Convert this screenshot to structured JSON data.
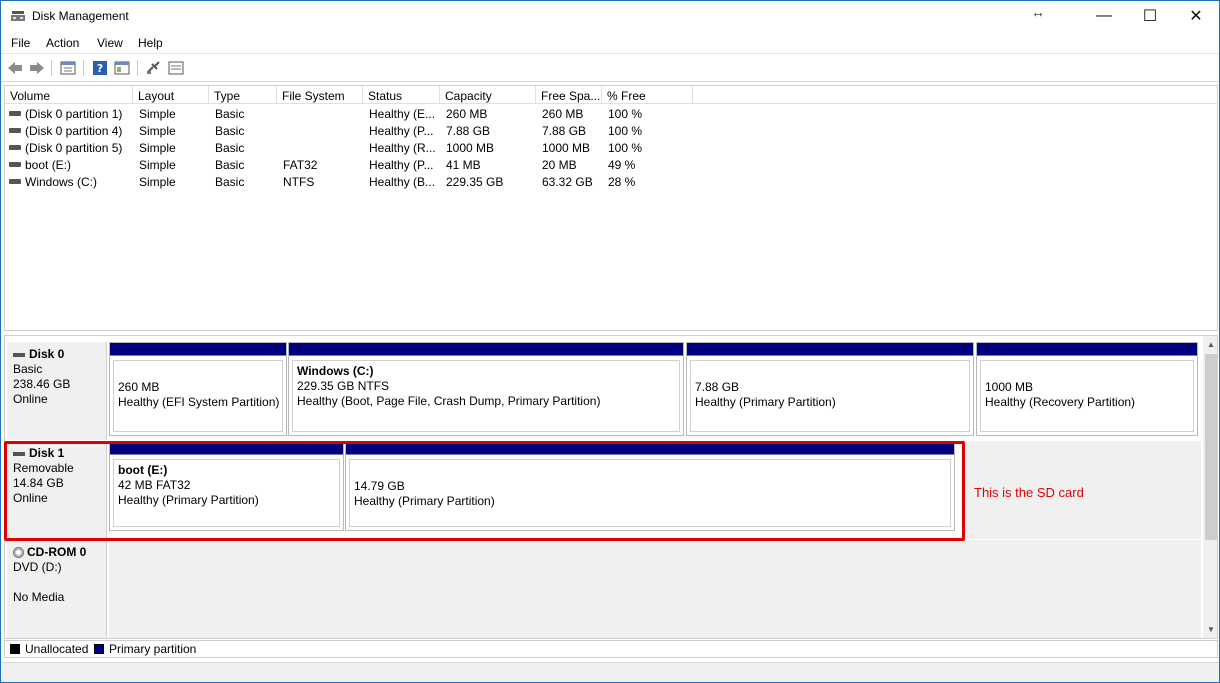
{
  "window": {
    "title": "Disk Management",
    "resize_glyph": "↔",
    "minimize": "—",
    "maximize": "☐",
    "close": "✕"
  },
  "menu": [
    "File",
    "Action",
    "View",
    "Help"
  ],
  "toolbar": {
    "icons": [
      "back-icon",
      "forward-icon",
      "properties-icon",
      "help-icon",
      "show-pane-icon",
      "connect-icon",
      "console-icon"
    ]
  },
  "volume_list": {
    "columns": [
      "Volume",
      "Layout",
      "Type",
      "File System",
      "Status",
      "Capacity",
      "Free Spa...",
      "% Free"
    ],
    "rows": [
      [
        "(Disk 0 partition 1)",
        "Simple",
        "Basic",
        "",
        "Healthy (E...",
        "260 MB",
        "260 MB",
        "100 %"
      ],
      [
        "(Disk 0 partition 4)",
        "Simple",
        "Basic",
        "",
        "Healthy (P...",
        "7.88 GB",
        "7.88 GB",
        "100 %"
      ],
      [
        "(Disk 0 partition 5)",
        "Simple",
        "Basic",
        "",
        "Healthy (R...",
        "1000 MB",
        "1000 MB",
        "100 %"
      ],
      [
        "boot (E:)",
        "Simple",
        "Basic",
        "FAT32",
        "Healthy (P...",
        "41 MB",
        "20 MB",
        "49 %"
      ],
      [
        "Windows (C:)",
        "Simple",
        "Basic",
        "NTFS",
        "Healthy (B...",
        "229.35 GB",
        "63.32 GB",
        "28 %"
      ]
    ]
  },
  "disks": {
    "disk0": {
      "name": "Disk 0",
      "type": "Basic",
      "size": "238.46 GB",
      "status": "Online",
      "partitions": [
        {
          "title": "",
          "size": "260 MB",
          "status": "Healthy (EFI System Partition)"
        },
        {
          "title": "Windows  (C:)",
          "size": "229.35 GB NTFS",
          "status": "Healthy (Boot, Page File, Crash Dump, Primary Partition)"
        },
        {
          "title": "",
          "size": "7.88 GB",
          "status": "Healthy (Primary Partition)"
        },
        {
          "title": "",
          "size": "1000 MB",
          "status": "Healthy (Recovery Partition)"
        }
      ]
    },
    "disk1": {
      "name": "Disk 1",
      "type": "Removable",
      "size": "14.84 GB",
      "status": "Online",
      "partitions": [
        {
          "title": "boot  (E:)",
          "size": "42 MB FAT32",
          "status": "Healthy (Primary Partition)"
        },
        {
          "title": "",
          "size": "14.79 GB",
          "status": "Healthy (Primary Partition)"
        }
      ]
    },
    "cdrom0": {
      "name": "CD-ROM 0",
      "type": "DVD (D:)",
      "status": "No Media"
    }
  },
  "annotation": "This is the SD card",
  "legend": {
    "unallocated": "Unallocated",
    "primary": "Primary partition",
    "unallocated_color": "#000000",
    "primary_color": "#000080"
  }
}
